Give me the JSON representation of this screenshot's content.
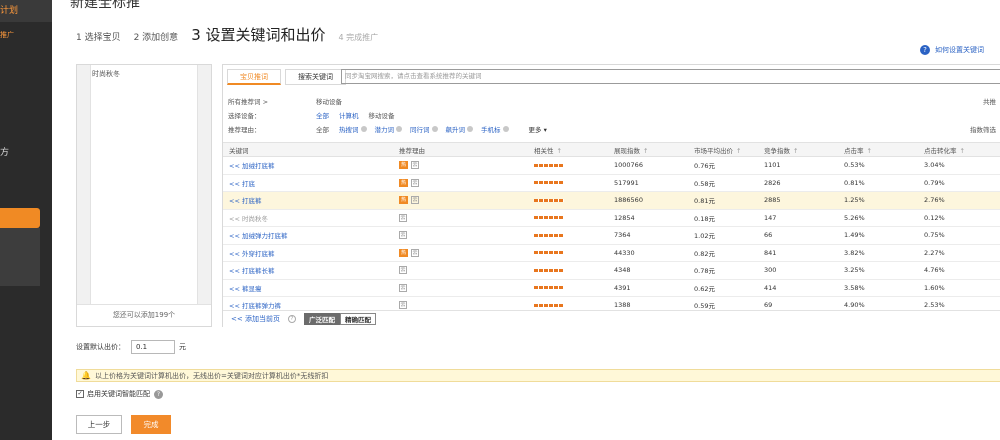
{
  "sidebar": {
    "title": "计划",
    "sub": "推广",
    "fang": "方"
  },
  "page": {
    "cut_title": "新建全标推"
  },
  "steps": [
    {
      "label": "1 选择宝贝"
    },
    {
      "label": "2 添加创意"
    },
    {
      "label": "3 设置关键词和出价"
    },
    {
      "label": "4 完成推广"
    }
  ],
  "help": {
    "icon": "?",
    "label": "如何设置关键词"
  },
  "kw_panel": {
    "item": "时尚秋冬",
    "footer": "您还可以添加199个"
  },
  "tabs": [
    {
      "label": "宝贝推词"
    },
    {
      "label": "搜索关键词"
    }
  ],
  "search": {
    "placeholder": "同步淘宝网搜索，请点击查看系统推荐的关键词"
  },
  "filters": {
    "all_label": "所有推荐词 >",
    "all_value": "移动设备",
    "device_label": "选择设备：",
    "device_opts": [
      "全部",
      "计算机",
      "移动设备"
    ],
    "reason_label": "推荐理由：",
    "reason_opts": [
      "全部",
      "热搜词",
      "潜力词",
      "同行词",
      "飙升词",
      "手机标"
    ],
    "more": "更多 ▾",
    "right_top": "共推",
    "right_filter": "指数筛选"
  },
  "table": {
    "headers": [
      "关键词",
      "推荐理由",
      "相关性",
      "展现指数",
      "市场平均出价",
      "竞争指数",
      "点击率",
      "点击转化率"
    ],
    "rows": [
      {
        "kw": "<< 加绒打底裤",
        "hot": true,
        "impr": "1000766",
        "bid": "0.76元",
        "comp": "1101",
        "ctr": "0.53%",
        "cvr": "3.04%"
      },
      {
        "kw": "<< 打底",
        "hot": true,
        "impr": "517991",
        "bid": "0.58元",
        "comp": "2826",
        "ctr": "0.81%",
        "cvr": "0.79%"
      },
      {
        "kw": "<< 打底裤",
        "hot": true,
        "impr": "1886560",
        "bid": "0.81元",
        "comp": "2885",
        "ctr": "1.25%",
        "cvr": "2.76%",
        "hl": true
      },
      {
        "kw": "<< 时尚秋冬",
        "hot": false,
        "impr": "12854",
        "bid": "0.18元",
        "comp": "147",
        "ctr": "5.26%",
        "cvr": "0.12%",
        "added": true
      },
      {
        "kw": "<< 加绒弹力打底裤",
        "hot": false,
        "impr": "7364",
        "bid": "1.02元",
        "comp": "66",
        "ctr": "1.49%",
        "cvr": "0.75%"
      },
      {
        "kw": "<< 外穿打底裤",
        "hot": true,
        "impr": "44330",
        "bid": "0.82元",
        "comp": "841",
        "ctr": "3.82%",
        "cvr": "2.27%"
      },
      {
        "kw": "<< 打底裤长裤",
        "hot": false,
        "impr": "4348",
        "bid": "0.78元",
        "comp": "300",
        "ctr": "3.25%",
        "cvr": "4.76%"
      },
      {
        "kw": "<< 裤显瘦",
        "hot": false,
        "impr": "4391",
        "bid": "0.62元",
        "comp": "414",
        "ctr": "3.58%",
        "cvr": "1.60%"
      },
      {
        "kw": "<< 打底裤弹力裤",
        "hot": false,
        "impr": "1388",
        "bid": "0.59元",
        "comp": "69",
        "ctr": "4.90%",
        "cvr": "2.53%"
      }
    ],
    "hot_tag": "热",
    "box_tag": "云",
    "sort_mark": "↑"
  },
  "table_footer": {
    "add_page": "<< 添加当前页",
    "q": "?",
    "broad": "广泛匹配",
    "exact": "精确匹配"
  },
  "bid": {
    "label": "设置默认出价：",
    "value": "0.1",
    "unit": "元"
  },
  "notice": {
    "icon": "🔔",
    "text": "以上价格为关键词计算机出价，无线出价=关键词对应计算机出价*无线折扣"
  },
  "smart": {
    "check": "✓",
    "label": "启用关键词智能匹配",
    "q": "?"
  },
  "buttons": {
    "prev": "上一步",
    "done": "完成"
  }
}
